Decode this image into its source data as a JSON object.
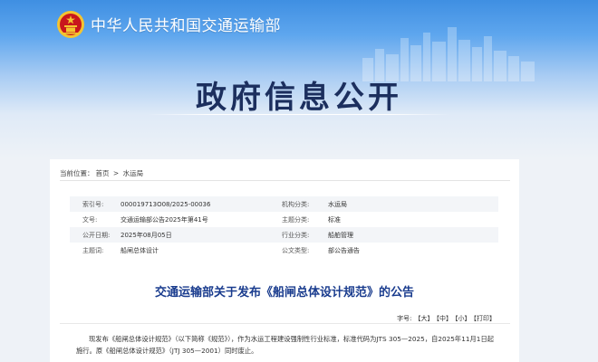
{
  "header": {
    "ministry_name": "中华人民共和国交通运输部",
    "section_title": "政府信息公开"
  },
  "colors": {
    "header_blue": "#3f8fe2",
    "title_navy": "#1c2f5e",
    "doc_title_blue": "#1a3c8e",
    "emblem_red": "#c8161d",
    "emblem_gold": "#f4c430"
  },
  "breadcrumb": {
    "label": "当前位置：",
    "home": "首页",
    "separator": ">",
    "current": "水运局"
  },
  "meta": {
    "index_label": "索引号:",
    "index_value": "000019713O08/2025-00036",
    "org_label": "机构分类:",
    "org_value": "水运局",
    "docno_label": "文号:",
    "docno_value": "交通运输部公告2025年第41号",
    "topic_label": "主题分类:",
    "topic_value": "标准",
    "date_label": "公开日期:",
    "date_value": "2025年08月05日",
    "industry_label": "行业分类:",
    "industry_value": "船舶管理",
    "subject_label": "主题词:",
    "subject_value": "船闸总体设计",
    "type_label": "公文类型:",
    "type_value": "部公告通告"
  },
  "document": {
    "title": "交通运输部关于发布《船闸总体设计规范》的公告",
    "font_label": "字号:",
    "font_large": "【大】",
    "font_medium": "【中】",
    "font_small": "【小】",
    "print": "【打印】",
    "body_line1": "现发布《船闸总体设计规范》（以下简称《规范》），作为水运工程建设强制性行业标准，标准代码为JTS 305—2025，自2025年11月1日起",
    "body_line2": "施行。原《船闸总体设计规范》（JTJ 305—2001）同时废止。"
  }
}
